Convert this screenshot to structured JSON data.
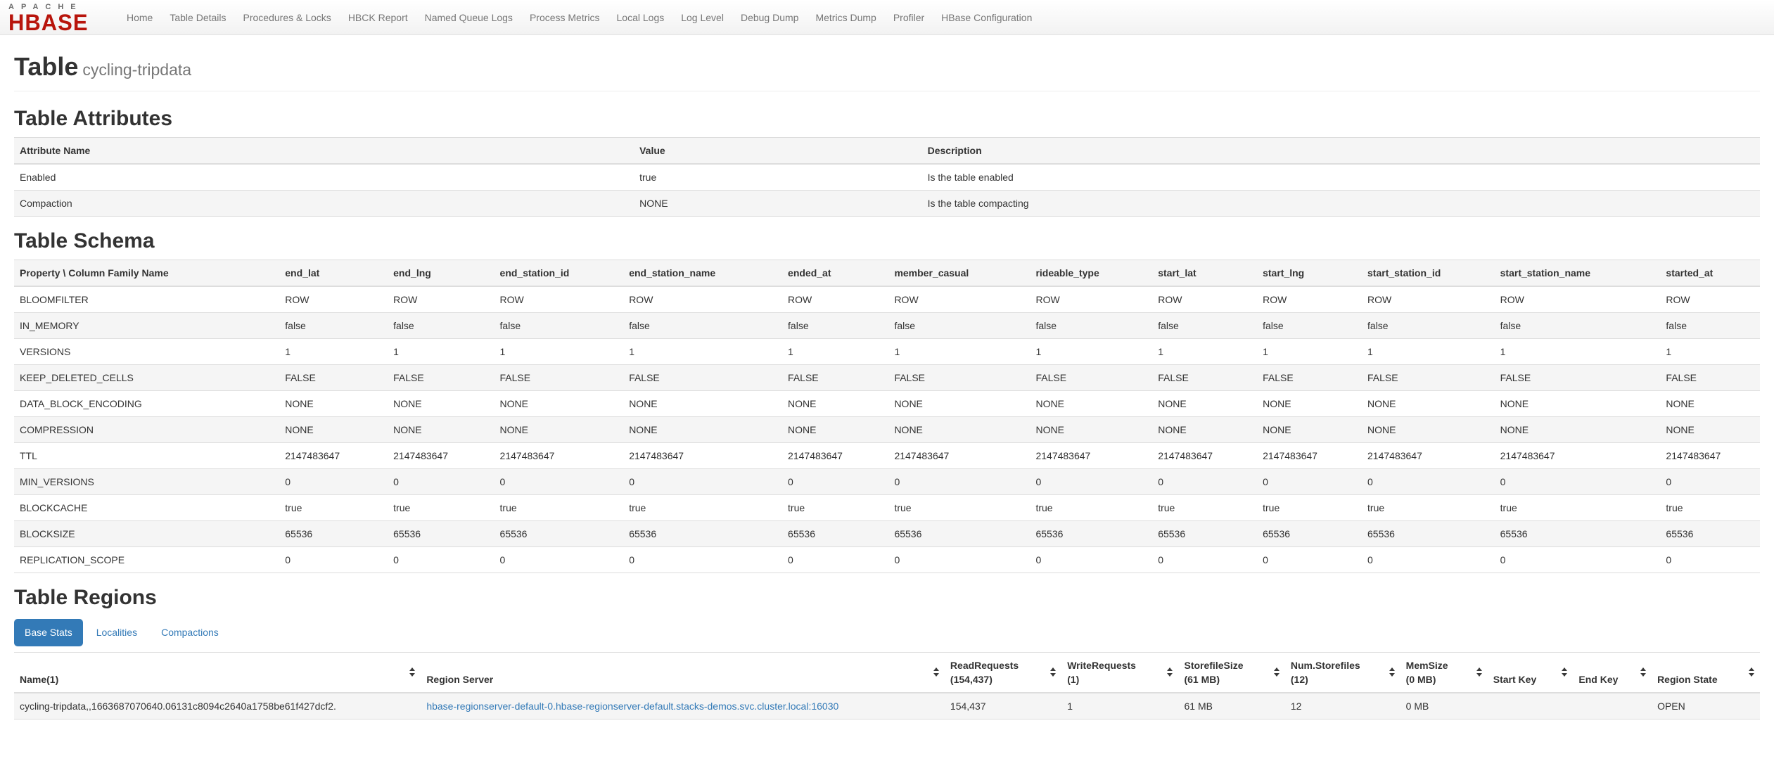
{
  "nav": {
    "brand_top": "APACHE",
    "brand_bottom": "HBASE",
    "items": [
      "Home",
      "Table Details",
      "Procedures & Locks",
      "HBCK Report",
      "Named Queue Logs",
      "Process Metrics",
      "Local Logs",
      "Log Level",
      "Debug Dump",
      "Metrics Dump",
      "Profiler",
      "HBase Configuration"
    ]
  },
  "page": {
    "title": "Table",
    "subtitle": "cycling-tripdata"
  },
  "colors": {
    "brand_red": "#b8150c",
    "accent_blue": "#337ab7",
    "stripe_gray": "#f5f5f5"
  },
  "attributes": {
    "heading": "Table Attributes",
    "columns": [
      "Attribute Name",
      "Value",
      "Description"
    ],
    "rows": [
      {
        "name": "Enabled",
        "value": "true",
        "description": "Is the table enabled"
      },
      {
        "name": "Compaction",
        "value": "NONE",
        "description": "Is the table compacting"
      }
    ]
  },
  "schema": {
    "heading": "Table Schema",
    "property_column": "Property \\ Column Family Name",
    "families": [
      "end_lat",
      "end_lng",
      "end_station_id",
      "end_station_name",
      "ended_at",
      "member_casual",
      "rideable_type",
      "start_lat",
      "start_lng",
      "start_station_id",
      "start_station_name",
      "started_at"
    ],
    "rows": [
      {
        "property": "BLOOMFILTER",
        "values": [
          "ROW",
          "ROW",
          "ROW",
          "ROW",
          "ROW",
          "ROW",
          "ROW",
          "ROW",
          "ROW",
          "ROW",
          "ROW",
          "ROW"
        ]
      },
      {
        "property": "IN_MEMORY",
        "values": [
          "false",
          "false",
          "false",
          "false",
          "false",
          "false",
          "false",
          "false",
          "false",
          "false",
          "false",
          "false"
        ]
      },
      {
        "property": "VERSIONS",
        "values": [
          "1",
          "1",
          "1",
          "1",
          "1",
          "1",
          "1",
          "1",
          "1",
          "1",
          "1",
          "1"
        ]
      },
      {
        "property": "KEEP_DELETED_CELLS",
        "values": [
          "FALSE",
          "FALSE",
          "FALSE",
          "FALSE",
          "FALSE",
          "FALSE",
          "FALSE",
          "FALSE",
          "FALSE",
          "FALSE",
          "FALSE",
          "FALSE"
        ]
      },
      {
        "property": "DATA_BLOCK_ENCODING",
        "values": [
          "NONE",
          "NONE",
          "NONE",
          "NONE",
          "NONE",
          "NONE",
          "NONE",
          "NONE",
          "NONE",
          "NONE",
          "NONE",
          "NONE"
        ]
      },
      {
        "property": "COMPRESSION",
        "values": [
          "NONE",
          "NONE",
          "NONE",
          "NONE",
          "NONE",
          "NONE",
          "NONE",
          "NONE",
          "NONE",
          "NONE",
          "NONE",
          "NONE"
        ]
      },
      {
        "property": "TTL",
        "values": [
          "2147483647",
          "2147483647",
          "2147483647",
          "2147483647",
          "2147483647",
          "2147483647",
          "2147483647",
          "2147483647",
          "2147483647",
          "2147483647",
          "2147483647",
          "2147483647"
        ]
      },
      {
        "property": "MIN_VERSIONS",
        "values": [
          "0",
          "0",
          "0",
          "0",
          "0",
          "0",
          "0",
          "0",
          "0",
          "0",
          "0",
          "0"
        ]
      },
      {
        "property": "BLOCKCACHE",
        "values": [
          "true",
          "true",
          "true",
          "true",
          "true",
          "true",
          "true",
          "true",
          "true",
          "true",
          "true",
          "true"
        ]
      },
      {
        "property": "BLOCKSIZE",
        "values": [
          "65536",
          "65536",
          "65536",
          "65536",
          "65536",
          "65536",
          "65536",
          "65536",
          "65536",
          "65536",
          "65536",
          "65536"
        ]
      },
      {
        "property": "REPLICATION_SCOPE",
        "values": [
          "0",
          "0",
          "0",
          "0",
          "0",
          "0",
          "0",
          "0",
          "0",
          "0",
          "0",
          "0"
        ]
      }
    ]
  },
  "regions": {
    "heading": "Table Regions",
    "tabs": [
      {
        "label": "Base Stats",
        "active": true
      },
      {
        "label": "Localities",
        "active": false
      },
      {
        "label": "Compactions",
        "active": false
      }
    ],
    "columns": [
      {
        "key": "name",
        "lines": [
          "Name(1)"
        ]
      },
      {
        "key": "region_server",
        "lines": [
          "Region Server"
        ]
      },
      {
        "key": "read_requests",
        "lines": [
          "ReadRequests",
          "(154,437)"
        ]
      },
      {
        "key": "write_requests",
        "lines": [
          "WriteRequests",
          "(1)"
        ]
      },
      {
        "key": "storefile_size",
        "lines": [
          "StorefileSize",
          "(61 MB)"
        ]
      },
      {
        "key": "num_storefiles",
        "lines": [
          "Num.Storefiles",
          "(12)"
        ]
      },
      {
        "key": "mem_size",
        "lines": [
          "MemSize",
          "(0 MB)"
        ]
      },
      {
        "key": "start_key",
        "lines": [
          "Start Key"
        ]
      },
      {
        "key": "end_key",
        "lines": [
          "End Key"
        ]
      },
      {
        "key": "region_state",
        "lines": [
          "Region State"
        ]
      }
    ],
    "rows": [
      {
        "name": "cycling-tripdata,,1663687070640.06131c8094c2640a1758be61f427dcf2.",
        "region_server": "hbase-regionserver-default-0.hbase-regionserver-default.stacks-demos.svc.cluster.local:16030",
        "read_requests": "154,437",
        "write_requests": "1",
        "storefile_size": "61 MB",
        "num_storefiles": "12",
        "mem_size": "0 MB",
        "start_key": "",
        "end_key": "",
        "region_state": "OPEN"
      }
    ]
  }
}
